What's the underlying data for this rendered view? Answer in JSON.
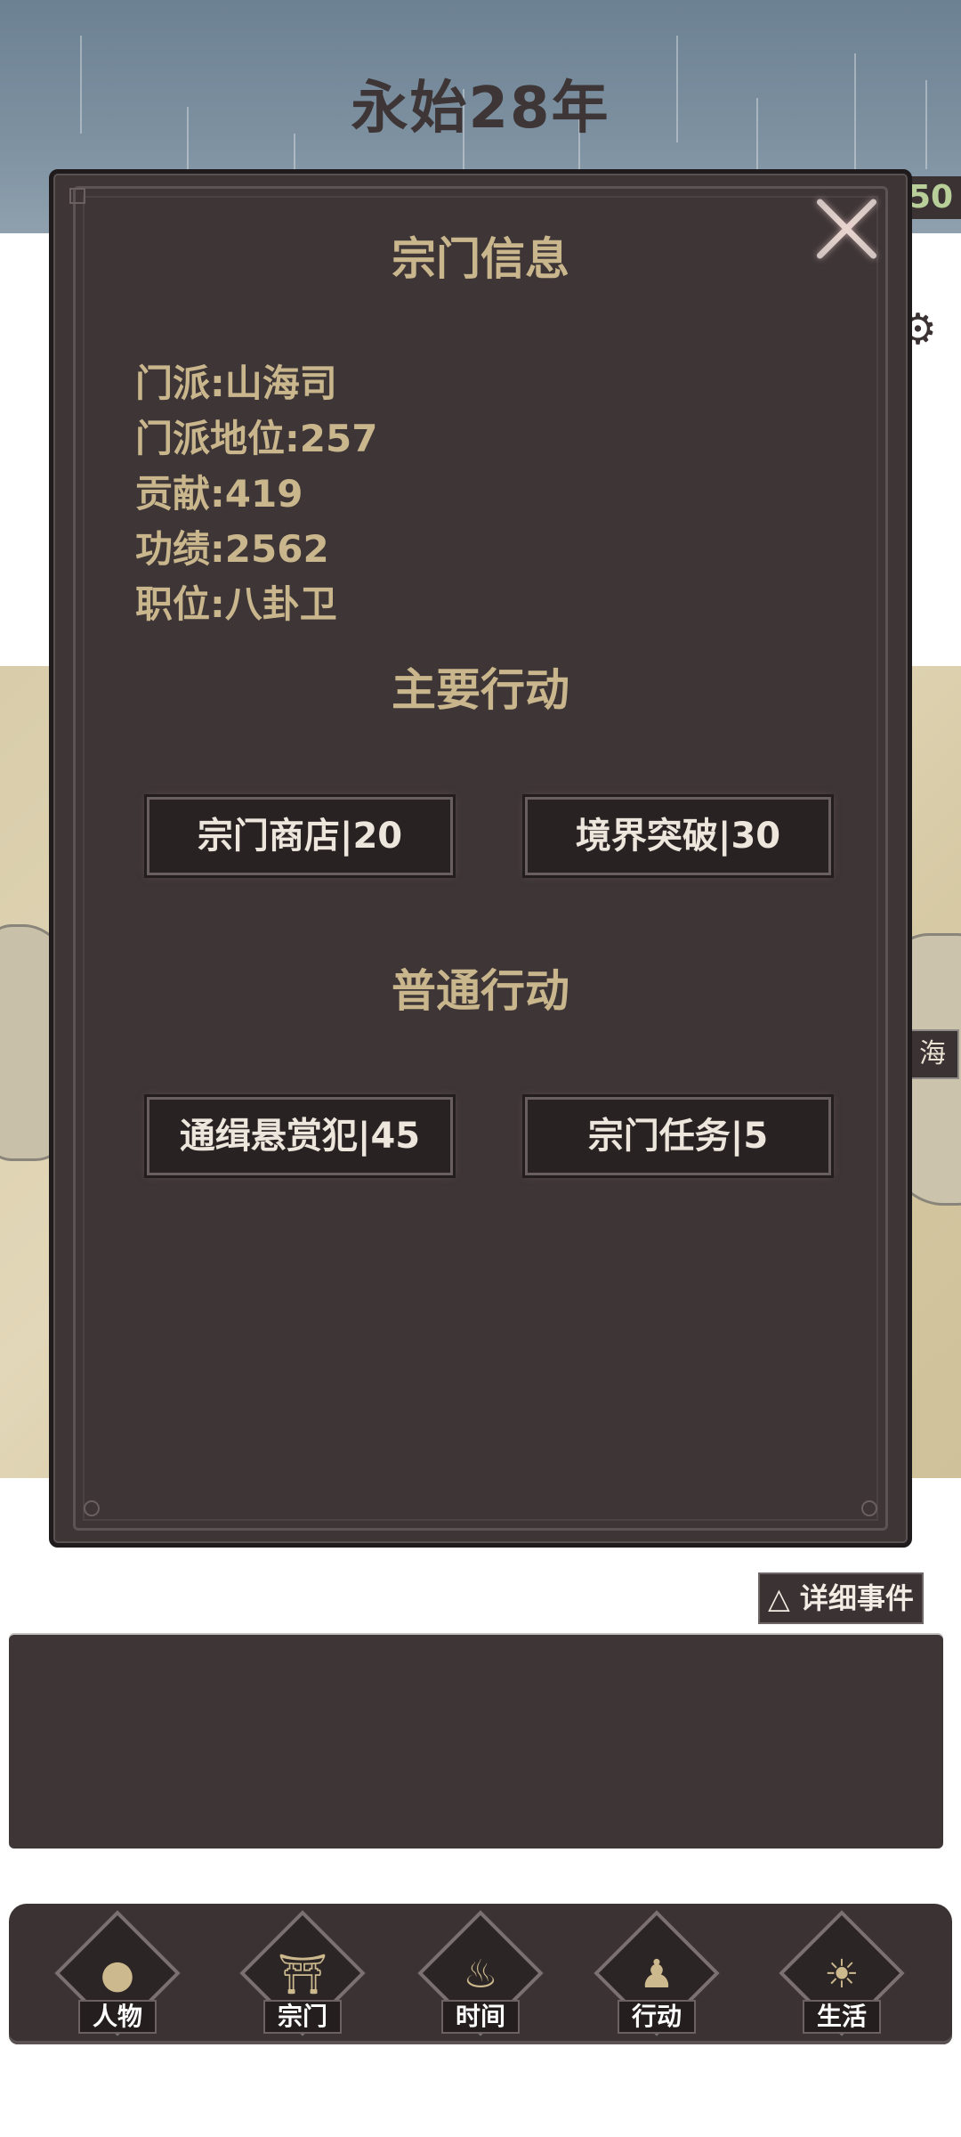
{
  "header": {
    "year_title": "永始28年",
    "stat_value": "50"
  },
  "map": {
    "region_label": "海"
  },
  "modal": {
    "title": "宗门信息",
    "info": [
      "门派:山海司",
      "门派地位:257",
      "贡献:419",
      "功绩:2562",
      "职位:八卦卫"
    ],
    "main_actions_title": "主要行动",
    "main_actions": [
      "宗门商店|20",
      "境界突破|30"
    ],
    "normal_actions_title": "普通行动",
    "normal_actions": [
      "通缉悬赏犯|45",
      "宗门任务|5"
    ],
    "close_icon": "close-icon"
  },
  "events": {
    "detail_button": "△ 详细事件"
  },
  "nav": {
    "items": [
      {
        "label": "人物",
        "icon": "person-icon"
      },
      {
        "label": "宗门",
        "icon": "gate-icon"
      },
      {
        "label": "时间",
        "icon": "incense-icon"
      },
      {
        "label": "行动",
        "icon": "action-icon"
      },
      {
        "label": "生活",
        "icon": "landscape-icon"
      }
    ]
  },
  "colors": {
    "panel": "#3d3536",
    "gold_text": "#c9b68c",
    "sky": "#7d91a1",
    "map": "#ddd1b0"
  }
}
